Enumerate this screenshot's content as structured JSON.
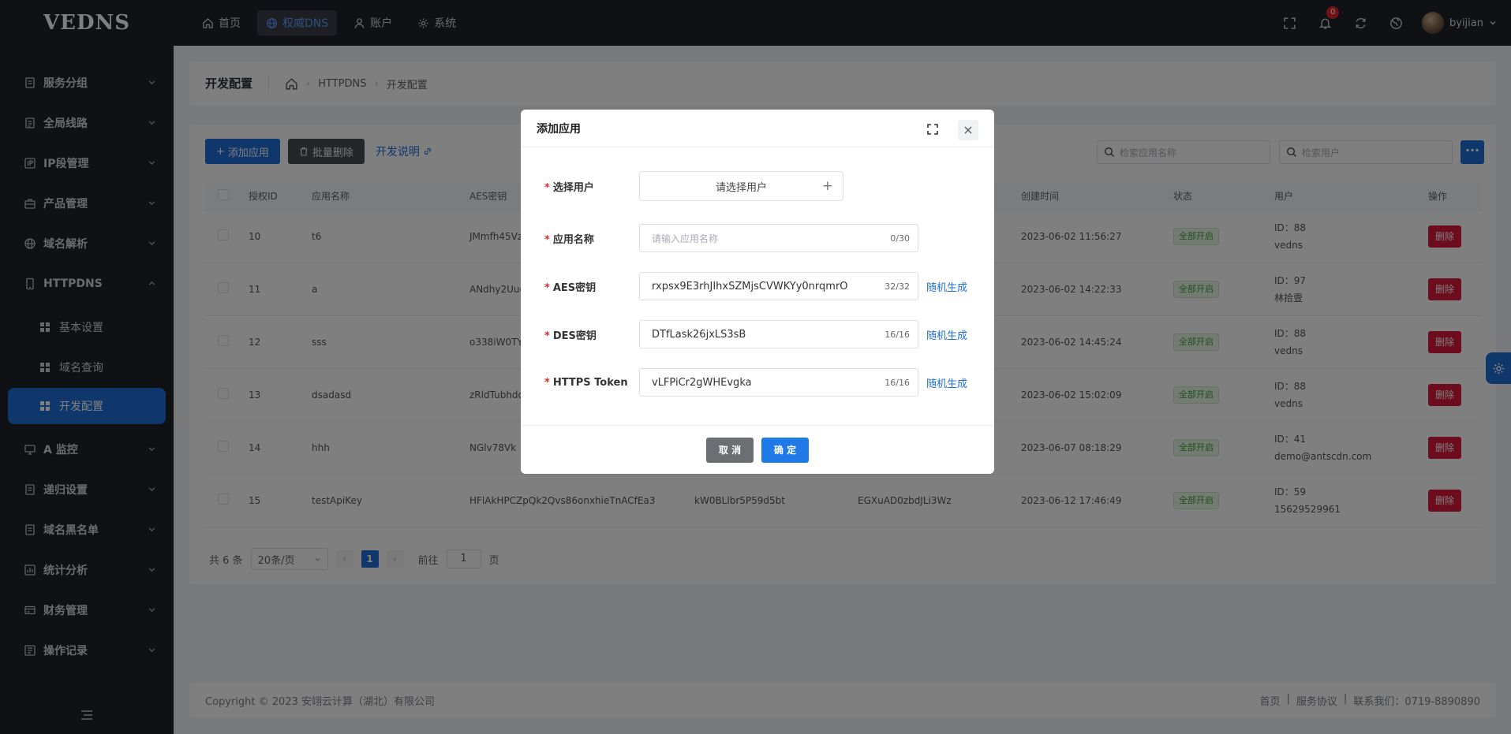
{
  "app": {
    "logo": "VEDNS"
  },
  "topnav": [
    {
      "label": "首页",
      "icon": "home-icon"
    },
    {
      "label": "权威DNS",
      "icon": "globe-icon",
      "active": true
    },
    {
      "label": "账户",
      "icon": "user-icon"
    },
    {
      "label": "系统",
      "icon": "gear-icon"
    }
  ],
  "topright": {
    "notification_count": "0",
    "username": "byijian"
  },
  "sidebar": {
    "items": [
      {
        "label": "服务分组"
      },
      {
        "label": "全局线路"
      },
      {
        "label": "IP段管理"
      },
      {
        "label": "产品管理"
      },
      {
        "label": "域名解析"
      },
      {
        "label": "HTTPDNS"
      },
      {
        "label": "A 监控"
      },
      {
        "label": "递归设置"
      },
      {
        "label": "域名黑名单"
      },
      {
        "label": "统计分析"
      },
      {
        "label": "财务管理"
      },
      {
        "label": "操作记录"
      }
    ],
    "sub_items": [
      {
        "label": "基本设置"
      },
      {
        "label": "域名查询"
      },
      {
        "label": "开发配置",
        "active": true
      }
    ]
  },
  "breadcrumb": {
    "title": "开发配置",
    "path1": "HTTPDNS",
    "path2": "开发配置"
  },
  "toolbar": {
    "add_label": "添加应用",
    "batch_delete_label": "批量删除",
    "doc_link": "开发说明",
    "search_app_placeholder": "检索应用名称",
    "search_user_placeholder": "检索用户"
  },
  "table": {
    "headers": [
      "授权ID",
      "应用名称",
      "AES密钥",
      "",
      "",
      "创建时间",
      "状态",
      "用户",
      "操作"
    ],
    "rows": [
      {
        "id": "10",
        "name": "t6",
        "aes": "JMmfh45Vz",
        "des": "",
        "token": "",
        "created": "2023-06-02 11:56:27",
        "status": "全部开启",
        "user_id": "ID：88",
        "user_name": "vedns",
        "action": "删除"
      },
      {
        "id": "11",
        "name": "a",
        "aes": "ANdhy2Uuc",
        "des": "",
        "token": "",
        "created": "2023-06-02 14:22:33",
        "status": "全部开启",
        "user_id": "ID：97",
        "user_name": "林拾壹",
        "action": "删除"
      },
      {
        "id": "12",
        "name": "sss",
        "aes": "o338iW0TY",
        "des": "",
        "token": "",
        "created": "2023-06-02 14:45:24",
        "status": "全部开启",
        "user_id": "ID：88",
        "user_name": "vedns",
        "action": "删除"
      },
      {
        "id": "13",
        "name": "dsadasd",
        "aes": "zRldTubhdo",
        "des": "",
        "token": "",
        "created": "2023-06-02 15:02:09",
        "status": "全部开启",
        "user_id": "ID：88",
        "user_name": "vedns",
        "action": "删除"
      },
      {
        "id": "14",
        "name": "hhh",
        "aes": "NGlv78Vk",
        "des": "",
        "token": "",
        "created": "2023-06-07 08:18:29",
        "status": "全部开启",
        "user_id": "ID：41",
        "user_name": "demo@antscdn.com",
        "action": "删除"
      },
      {
        "id": "15",
        "name": "testApiKey",
        "aes": "HFlAkHPCZpQk2Qvs86onxhieTnACfEa3",
        "des": "kW0BLlbr5P59d5bt",
        "token": "EGXuAD0zbdJLi3Wz",
        "created": "2023-06-12 17:46:49",
        "status": "全部开启",
        "user_id": "ID：59",
        "user_name": "15629529961",
        "action": "删除"
      }
    ]
  },
  "pagination": {
    "total": "共 6 条",
    "page_size": "20条/页",
    "current": "1",
    "goto_label": "前往",
    "goto_value": "1",
    "page_suffix": "页",
    "prev": "‹",
    "next": "›"
  },
  "footer": {
    "copyright": "Copyright © 2023 安翊云计算（湖北）有限公司",
    "links": [
      "首页",
      "|",
      "服务协议",
      "|",
      "联系我们：0719-8890890"
    ]
  },
  "modal": {
    "title": "添加应用",
    "fields": {
      "user": {
        "label": "选择用户",
        "button": "请选择用户"
      },
      "app_name": {
        "label": "应用名称",
        "placeholder": "请输入应用名称",
        "count": "0/30"
      },
      "aes": {
        "label": "AES密钥",
        "value": "rxpsx9E3rhJIhxSZMjsCVWKYy0nrqmrO",
        "count": "32/32",
        "gen": "随机生成"
      },
      "des": {
        "label": "DES密钥",
        "value": "DTfLask26jxLS3sB",
        "count": "16/16",
        "gen": "随机生成"
      },
      "token": {
        "label": "HTTPS Token",
        "value": "vLFPiCr2gWHEvgka",
        "count": "16/16",
        "gen": "随机生成"
      }
    },
    "cancel_label": "取 消",
    "ok_label": "确 定"
  },
  "colors": {
    "primary": "#1f6fd8",
    "danger": "#d9183b",
    "sidebar_bg": "#1f232b",
    "success": "#3ea23a"
  }
}
